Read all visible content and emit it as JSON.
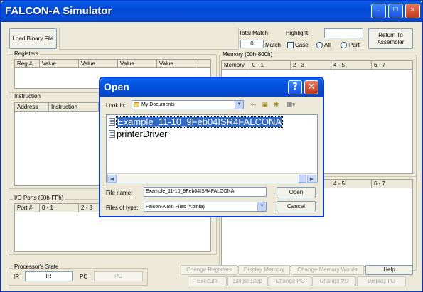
{
  "window": {
    "title": "FALCON-A Simulator",
    "controls": {
      "minimize_icon": "_",
      "maximize_icon": "□",
      "close_icon": "✕"
    }
  },
  "toolbar": {
    "load_binary_label": "Load Binary File",
    "total_match_label": "Total Match",
    "total_match_value": "0",
    "match_label": "Match",
    "highlight_label": "Highlight",
    "highlight_value": "",
    "case_label": "Case",
    "all_label": "All",
    "part_label": "Part",
    "return_label": "Return To Assembler"
  },
  "registers": {
    "title": "Registers",
    "columns": [
      "Reg #",
      "Value",
      "Value",
      "Value",
      "Value"
    ]
  },
  "memory": {
    "title": "Memory (00h-800h)",
    "columns": [
      "Memory",
      "0 - 1",
      "2 - 3",
      "4 - 5",
      "6 - 7"
    ]
  },
  "instruction": {
    "title": "Instruction",
    "columns": [
      "Address",
      "Instruction"
    ]
  },
  "io_ports": {
    "title": "I/O Ports (00h-FFh)",
    "columns": [
      "Port #",
      "0 - 1",
      "2 - 3"
    ]
  },
  "lower_memory": {
    "columns": [
      "4 - 5",
      "6 - 7"
    ]
  },
  "processor": {
    "title": "Processor's State",
    "ir_label": "IR",
    "ir_value": "IR",
    "pc_label": "PC",
    "pc_value": "PC"
  },
  "actions": {
    "change_registers": "Change Registers",
    "display_memory": "Display Memory",
    "change_memory_words": "Change Memory Words",
    "help": "Help",
    "execute": "Execute",
    "single_step": "Single Step",
    "change_pc": "Change PC",
    "change_io": "Change I/O",
    "display_io": "Display I/O"
  },
  "open_dialog": {
    "title": "Open",
    "help_icon": "?",
    "close_icon": "✕",
    "look_in_label": "Look in:",
    "look_in_value": "My Documents",
    "files": [
      "Example_11-10_9Feb04ISR4FALCONA",
      "printerDriver"
    ],
    "selected_file_index": 0,
    "file_name_label": "File name:",
    "file_name_value": "Example_11-10_9Feb04ISR4FALCONA",
    "file_type_label": "Files of type:",
    "file_type_value": "Falcon-A Bin Files (*.binfa)",
    "open_label": "Open",
    "cancel_label": "Cancel"
  }
}
